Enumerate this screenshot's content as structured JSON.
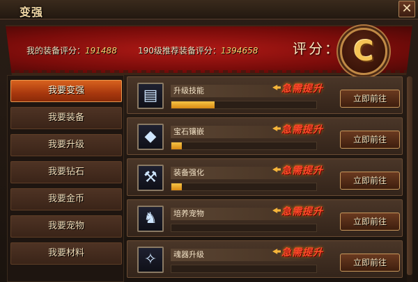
{
  "window": {
    "title": "变强",
    "close_glyph": "✕"
  },
  "banner": {
    "my_score_label": "我的装备评分：",
    "my_score_value": "191488",
    "recommend_label": "190级推荐装备评分：",
    "recommend_value": "1394658",
    "rating_label": "评分：",
    "grade": "C"
  },
  "menu": {
    "items": [
      {
        "label": "我要变强",
        "active": true
      },
      {
        "label": "我要装备",
        "active": false
      },
      {
        "label": "我要升级",
        "active": false
      },
      {
        "label": "我要钻石",
        "active": false
      },
      {
        "label": "我要金币",
        "active": false
      },
      {
        "label": "我要宠物",
        "active": false
      },
      {
        "label": "我要材料",
        "active": false
      }
    ]
  },
  "tasks": {
    "urgent_label": "急需提升",
    "go_label": "立即前往",
    "items": [
      {
        "name": "升级技能",
        "icon": "skill-book-icon",
        "progress": 0.3
      },
      {
        "name": "宝石镶嵌",
        "icon": "gem-icon",
        "progress": 0.07
      },
      {
        "name": "装备强化",
        "icon": "anvil-icon",
        "progress": 0.07
      },
      {
        "name": "培养宠物",
        "icon": "pet-icon",
        "progress": 0
      },
      {
        "name": "魂器升级",
        "icon": "soul-artifact-icon",
        "progress": 0
      }
    ]
  },
  "colors": {
    "banner_red": "#9a1210",
    "accent_orange": "#c8501a",
    "progress_gold": "#e8a42a",
    "urgent_red": "#ff4a2a"
  }
}
